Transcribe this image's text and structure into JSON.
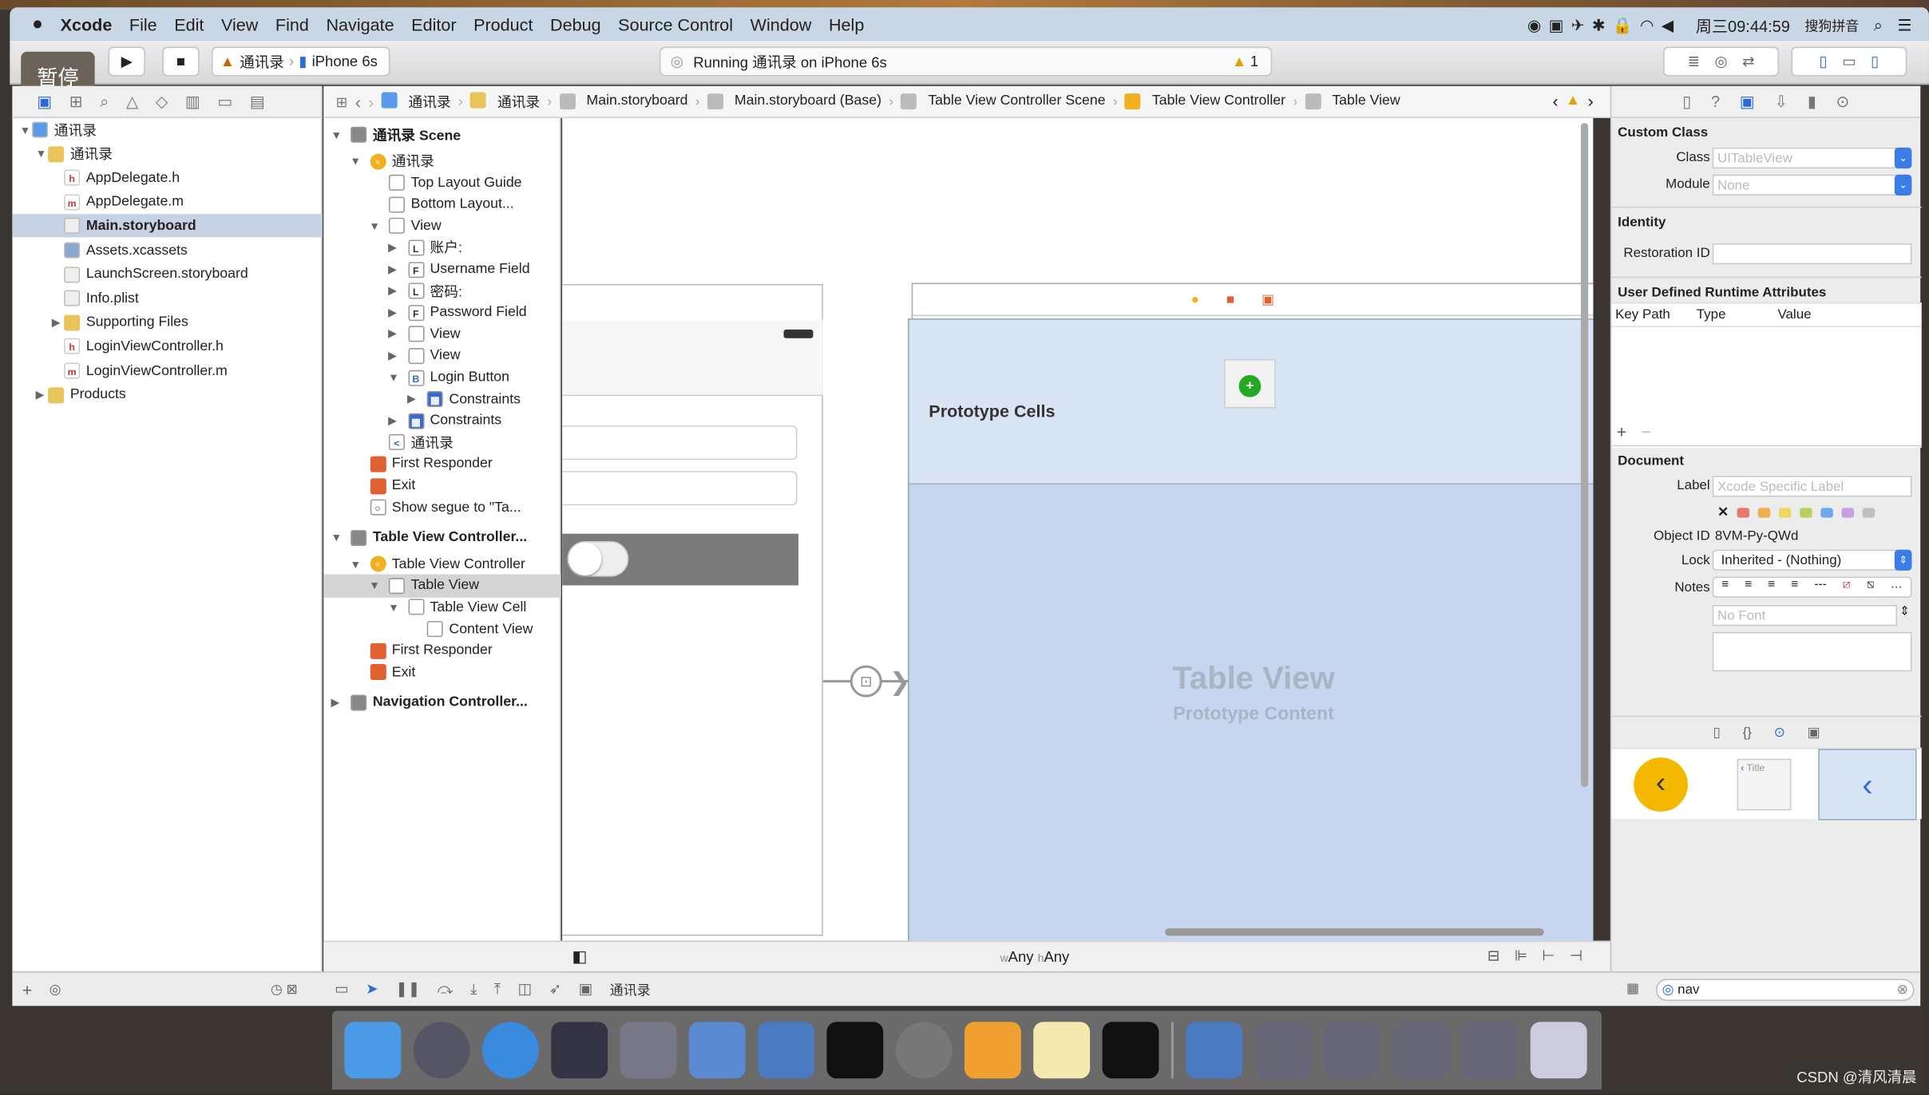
{
  "menubar": {
    "apple": "",
    "items": [
      "Xcode",
      "File",
      "Edit",
      "View",
      "Find",
      "Navigate",
      "Editor",
      "Product",
      "Debug",
      "Source Control",
      "Window",
      "Help"
    ],
    "clock": "周三09:44:59",
    "ime": "搜狗拼音"
  },
  "toolbar": {
    "pause_overlay": "暂停",
    "scheme": "通讯录",
    "device": "iPhone 6s",
    "status": "Running 通讯录 on iPhone 6s",
    "warning_count": "1"
  },
  "navigator": {
    "items": [
      {
        "label": "通讯录",
        "level": 0,
        "open": true,
        "type": "project"
      },
      {
        "label": "通讯录",
        "level": 1,
        "open": true,
        "type": "folder"
      },
      {
        "label": "AppDelegate.h",
        "level": 2,
        "type": "h"
      },
      {
        "label": "AppDelegate.m",
        "level": 2,
        "type": "m"
      },
      {
        "label": "Main.storyboard",
        "level": 2,
        "type": "file",
        "selected": true
      },
      {
        "label": "Assets.xcassets",
        "level": 2,
        "type": "asset"
      },
      {
        "label": "LaunchScreen.storyboard",
        "level": 2,
        "type": "file"
      },
      {
        "label": "Info.plist",
        "level": 2,
        "type": "file"
      },
      {
        "label": "Supporting Files",
        "level": 2,
        "type": "folder",
        "closed": true
      },
      {
        "label": "LoginViewController.h",
        "level": 2,
        "type": "h"
      },
      {
        "label": "LoginViewController.m",
        "level": 2,
        "type": "m"
      },
      {
        "label": "Products",
        "level": 1,
        "type": "folder",
        "closed": true
      }
    ]
  },
  "jumpbar": [
    "通讯录",
    "通讯录",
    "Main.storyboard",
    "Main.storyboard (Base)",
    "Table View Controller Scene",
    "Table View Controller",
    "Table View"
  ],
  "outline": {
    "items": [
      {
        "label": "通讯录 Scene",
        "level": 0,
        "tri": "▼",
        "icon": "",
        "bold": true
      },
      {
        "label": "通讯录",
        "level": 1,
        "tri": "▼",
        "icon": "●"
      },
      {
        "label": "Top Layout Guide",
        "level": 2,
        "icon": ""
      },
      {
        "label": "Bottom Layout...",
        "level": 2,
        "icon": ""
      },
      {
        "label": "View",
        "level": 2,
        "tri": "▼",
        "icon": ""
      },
      {
        "label": "账户:",
        "level": 3,
        "tri": "▶",
        "icon": "L"
      },
      {
        "label": "Username Field",
        "level": 3,
        "tri": "▶",
        "icon": "F"
      },
      {
        "label": "密码:",
        "level": 3,
        "tri": "▶",
        "icon": "L"
      },
      {
        "label": "Password Field",
        "level": 3,
        "tri": "▶",
        "icon": "F"
      },
      {
        "label": "View",
        "level": 3,
        "tri": "▶",
        "icon": ""
      },
      {
        "label": "View",
        "level": 3,
        "tri": "▶",
        "icon": ""
      },
      {
        "label": "Login Button",
        "level": 3,
        "tri": "▼",
        "icon": "B"
      },
      {
        "label": "Constraints",
        "level": 4,
        "tri": "▶",
        "icon": "▦"
      },
      {
        "label": "Constraints",
        "level": 3,
        "tri": "▶",
        "icon": "▦"
      },
      {
        "label": "通讯录",
        "level": 2,
        "icon": "<"
      },
      {
        "label": "First Responder",
        "level": 1,
        "icon": "■"
      },
      {
        "label": "Exit",
        "level": 1,
        "icon": "■"
      },
      {
        "label": "Show segue to \"Ta...",
        "level": 1,
        "icon": "○"
      },
      {
        "label": "Table View Controller...",
        "level": 0,
        "tri": "▼",
        "icon": "",
        "bold": true,
        "gap": true
      },
      {
        "label": "Table View Controller",
        "level": 1,
        "tri": "▼",
        "icon": "●"
      },
      {
        "label": "Table View",
        "level": 2,
        "tri": "▼",
        "icon": "",
        "selected": true
      },
      {
        "label": "Table View Cell",
        "level": 3,
        "tri": "▼",
        "icon": ""
      },
      {
        "label": "Content View",
        "level": 4,
        "icon": ""
      },
      {
        "label": "First Responder",
        "level": 1,
        "icon": "■"
      },
      {
        "label": "Exit",
        "level": 1,
        "icon": "■"
      },
      {
        "label": "Navigation Controller...",
        "level": 0,
        "tri": "▶",
        "icon": "",
        "bold": true,
        "gap": true
      }
    ]
  },
  "canvas": {
    "prototype_cells": "Prototype Cells",
    "table_view": "Table View",
    "prototype_content": "Prototype Content",
    "size_class_w": "w",
    "size_class_w_val": "Any",
    "size_class_h": "h",
    "size_class_h_val": "Any"
  },
  "inspector": {
    "custom_class": {
      "title": "Custom Class",
      "class_label": "Class",
      "class_placeholder": "UITableView",
      "module_label": "Module",
      "module_placeholder": "None"
    },
    "identity": {
      "title": "Identity",
      "restoration_label": "Restoration ID",
      "restoration_value": ""
    },
    "runtime": {
      "title": "User Defined Runtime Attributes",
      "columns": [
        "Key Path",
        "Type",
        "Value"
      ],
      "add": "+",
      "remove": "−"
    },
    "document": {
      "title": "Document",
      "label_label": "Label",
      "label_placeholder": "Xcode Specific Label",
      "object_id_label": "Object ID",
      "object_id": "8VM-Py-QWd",
      "lock_label": "Lock",
      "lock_value": "Inherited - (Nothing)",
      "notes_label": "Notes",
      "font_placeholder": "No Font",
      "label_colors": [
        "#e8786a",
        "#f0b050",
        "#ecd860",
        "#b8d060",
        "#70a8f0",
        "#c8a0e0",
        "#c0c0c0"
      ]
    },
    "library_item_title": "Title",
    "filter_value": "nav"
  },
  "debugbar": {
    "target": "通讯录"
  },
  "watermark": "CSDN @清风清晨"
}
